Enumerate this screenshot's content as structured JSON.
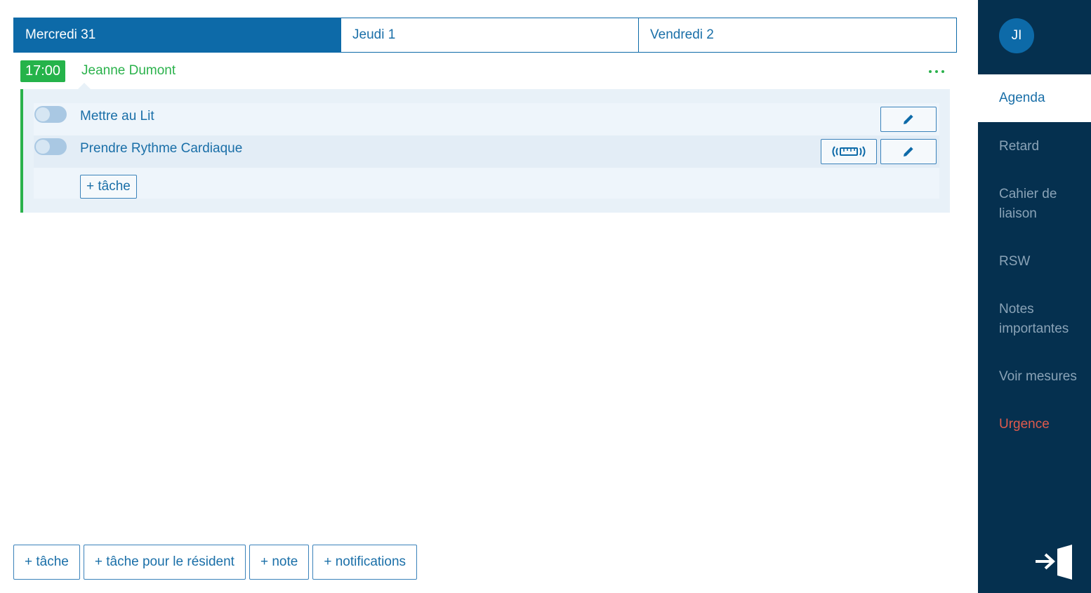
{
  "day_tabs": [
    {
      "label": "Mercredi 31",
      "active": true
    },
    {
      "label": "Jeudi 1",
      "active": false
    },
    {
      "label": "Vendredi 2",
      "active": false
    }
  ],
  "appointment": {
    "time": "17:00",
    "resident": "Jeanne Dumont",
    "tasks": [
      {
        "label": "Mettre au Lit",
        "done": false,
        "icons": [
          "pencil-icon"
        ]
      },
      {
        "label": "Prendre Rythme Cardiaque",
        "done": false,
        "icons": [
          "measure-device-icon",
          "pencil-icon"
        ]
      }
    ],
    "add_task_label": "+ tâche"
  },
  "bottom_actions": [
    {
      "label": "+ tâche"
    },
    {
      "label": "+ tâche pour le résident"
    },
    {
      "label": "+ note"
    },
    {
      "label": "+ notifications"
    }
  ],
  "sidebar": {
    "avatar_initials": "JI",
    "items": [
      {
        "label": "Agenda",
        "active": true
      },
      {
        "label": "Retard"
      },
      {
        "label": "Cahier de liaison"
      },
      {
        "label": "RSW"
      },
      {
        "label": "Notes importantes"
      },
      {
        "label": "Voir mesures"
      },
      {
        "label": "Urgence"
      }
    ],
    "logout_icon": "logout-icon"
  },
  "colors": {
    "primary": "#0d6aa8",
    "success": "#25b34a",
    "sidebar_bg": "#05304f",
    "urgent": "#e05a4c",
    "task_bg": "#e8f1f8"
  }
}
